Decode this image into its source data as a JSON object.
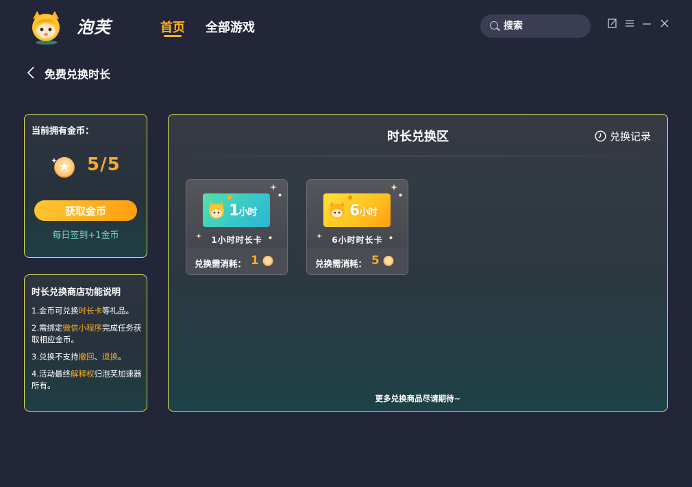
{
  "header": {
    "brand": "泡芙",
    "nav": [
      {
        "label": "首页",
        "active": true
      },
      {
        "label": "全部游戏",
        "active": false
      }
    ],
    "search_placeholder": "搜索"
  },
  "page": {
    "title": "免费兑换时长"
  },
  "coin_panel": {
    "label": "当前拥有金币：",
    "count": "5/5",
    "button": "获取金币",
    "daily_tip": "每日签到+1金币"
  },
  "rules_panel": {
    "title": "时长兑换商店功能说明",
    "rules": [
      {
        "pre": "1.金币可兑换",
        "hl": "时长卡",
        "post": "等礼品。",
        "hl2": "",
        "post2": ""
      },
      {
        "pre": "2.需绑定",
        "hl": "微信小程序",
        "post": "完成任务获取相应金币。",
        "hl2": "",
        "post2": ""
      },
      {
        "pre": "3.兑换不支持",
        "hl": "撤回",
        "post": "、",
        "hl2": "退换",
        "post2": "。"
      },
      {
        "pre": "4.活动最终",
        "hl": "解释权",
        "post": "归泡芙加速器所有。",
        "hl2": "",
        "post2": ""
      }
    ]
  },
  "exchange_zone": {
    "title": "时长兑换区",
    "history_label": "兑换记录",
    "cost_label": "兑换需消耗：",
    "cards": [
      {
        "ticket_num": "1",
        "ticket_unit": "小时",
        "name": "1小时时长卡",
        "cost": "1",
        "theme": "green"
      },
      {
        "ticket_num": "6",
        "ticket_unit": "小时",
        "name": "6小时时长卡",
        "cost": "5",
        "theme": "yellow"
      }
    ],
    "more_text": "更多兑换商品尽请期待~"
  },
  "colors": {
    "accent": "#ffb21f",
    "coin": "#f7a928",
    "panel_border": "#d8e35a",
    "tip_green": "#6fd6bd"
  }
}
